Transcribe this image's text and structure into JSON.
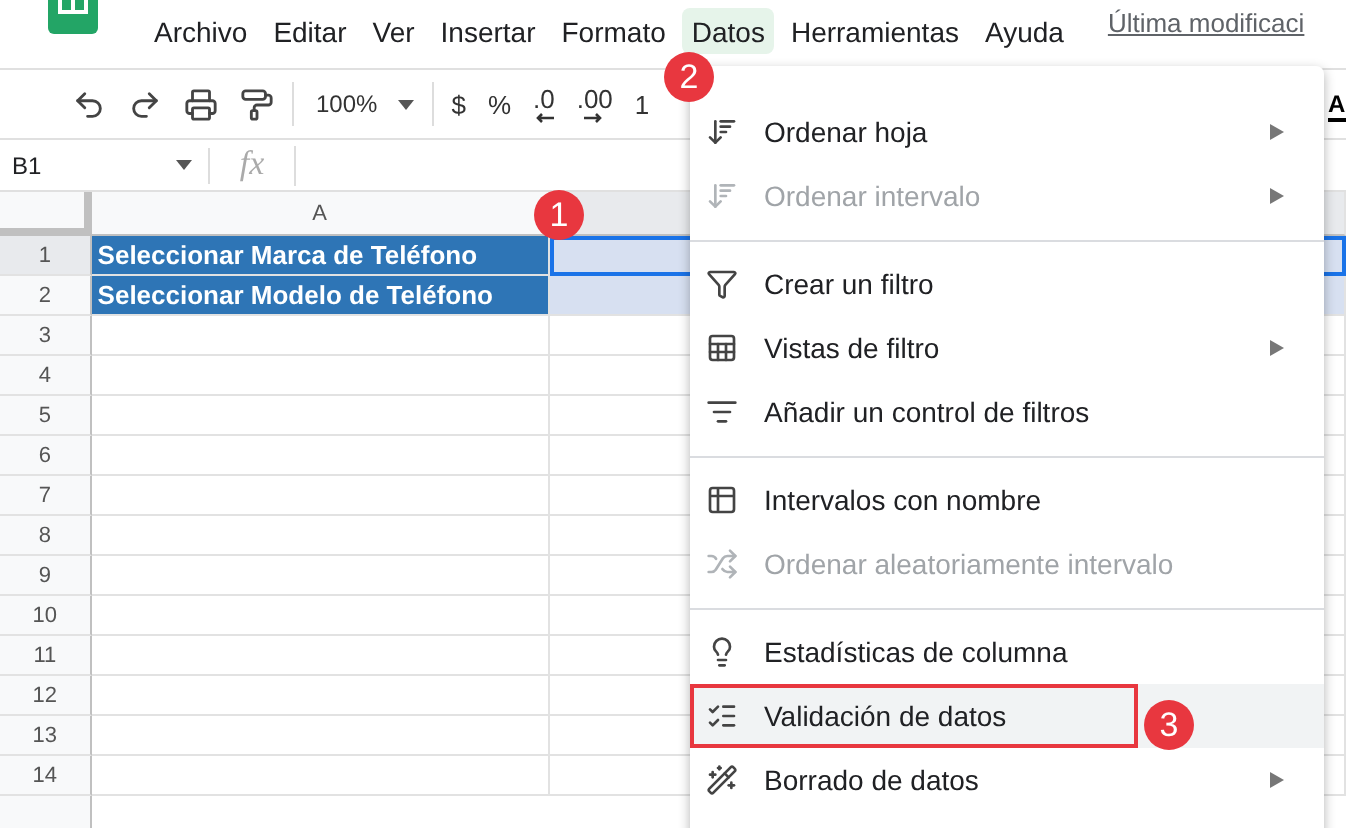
{
  "menu_bar": {
    "items": [
      {
        "label": "Archivo",
        "selected": false
      },
      {
        "label": "Editar",
        "selected": false
      },
      {
        "label": "Ver",
        "selected": false
      },
      {
        "label": "Insertar",
        "selected": false
      },
      {
        "label": "Formato",
        "selected": false
      },
      {
        "label": "Datos",
        "selected": true
      },
      {
        "label": "Herramientas",
        "selected": false
      },
      {
        "label": "Ayuda",
        "selected": false
      }
    ],
    "last_edit": "Última modificaci"
  },
  "toolbar": {
    "zoom": "100%",
    "formats": [
      "$",
      "%",
      ".0",
      ".00",
      "1"
    ],
    "font_button": "A"
  },
  "formula_bar": {
    "cell_ref": "B1",
    "fx": "fx"
  },
  "grid": {
    "columns": [
      {
        "label": "A",
        "selected": false
      },
      {
        "selected": true
      }
    ],
    "rows": [
      {
        "label": "1",
        "selected": true,
        "text": "Seleccionar Marca de Teléfono"
      },
      {
        "label": "2",
        "selected": false,
        "text": "Seleccionar Modelo de Teléfono"
      },
      {
        "label": "3",
        "selected": false
      },
      {
        "label": "4",
        "selected": false
      },
      {
        "label": "5",
        "selected": false
      },
      {
        "label": "6",
        "selected": false
      },
      {
        "label": "7",
        "selected": false
      },
      {
        "label": "8",
        "selected": false
      },
      {
        "label": "9",
        "selected": false
      },
      {
        "label": "10",
        "selected": false
      },
      {
        "label": "11",
        "selected": false
      },
      {
        "label": "12",
        "selected": false
      },
      {
        "label": "13",
        "selected": false
      },
      {
        "label": "14",
        "selected": false
      }
    ]
  },
  "menu": {
    "groups": [
      [
        {
          "label": "Ordenar hoja",
          "disabled": false,
          "submenu": true,
          "highlighted": false,
          "outlined": false
        },
        {
          "label": "Ordenar intervalo",
          "disabled": true,
          "submenu": true,
          "highlighted": false,
          "outlined": false
        }
      ],
      [
        {
          "label": "Crear un filtro",
          "disabled": false,
          "submenu": false,
          "highlighted": false,
          "outlined": false
        },
        {
          "label": "Vistas de filtro",
          "disabled": false,
          "submenu": true,
          "highlighted": false,
          "outlined": false
        },
        {
          "label": "Añadir un control de filtros",
          "disabled": false,
          "submenu": false,
          "highlighted": false,
          "outlined": false
        }
      ],
      [
        {
          "label": "Intervalos con nombre",
          "disabled": false,
          "submenu": false,
          "highlighted": false,
          "outlined": false
        },
        {
          "label": "Ordenar aleatoriamente intervalo",
          "disabled": true,
          "submenu": false,
          "highlighted": false,
          "outlined": false
        }
      ],
      [
        {
          "label": "Estadísticas de columna",
          "disabled": false,
          "submenu": false,
          "highlighted": false,
          "outlined": false
        },
        {
          "label": "Validación de datos",
          "disabled": false,
          "submenu": false,
          "highlighted": true,
          "outlined": true
        },
        {
          "label": "Borrado de datos",
          "disabled": false,
          "submenu": true,
          "highlighted": false,
          "outlined": false
        }
      ]
    ]
  },
  "annotations": [
    {
      "label": "1"
    },
    {
      "label": "2"
    },
    {
      "label": "3"
    }
  ]
}
